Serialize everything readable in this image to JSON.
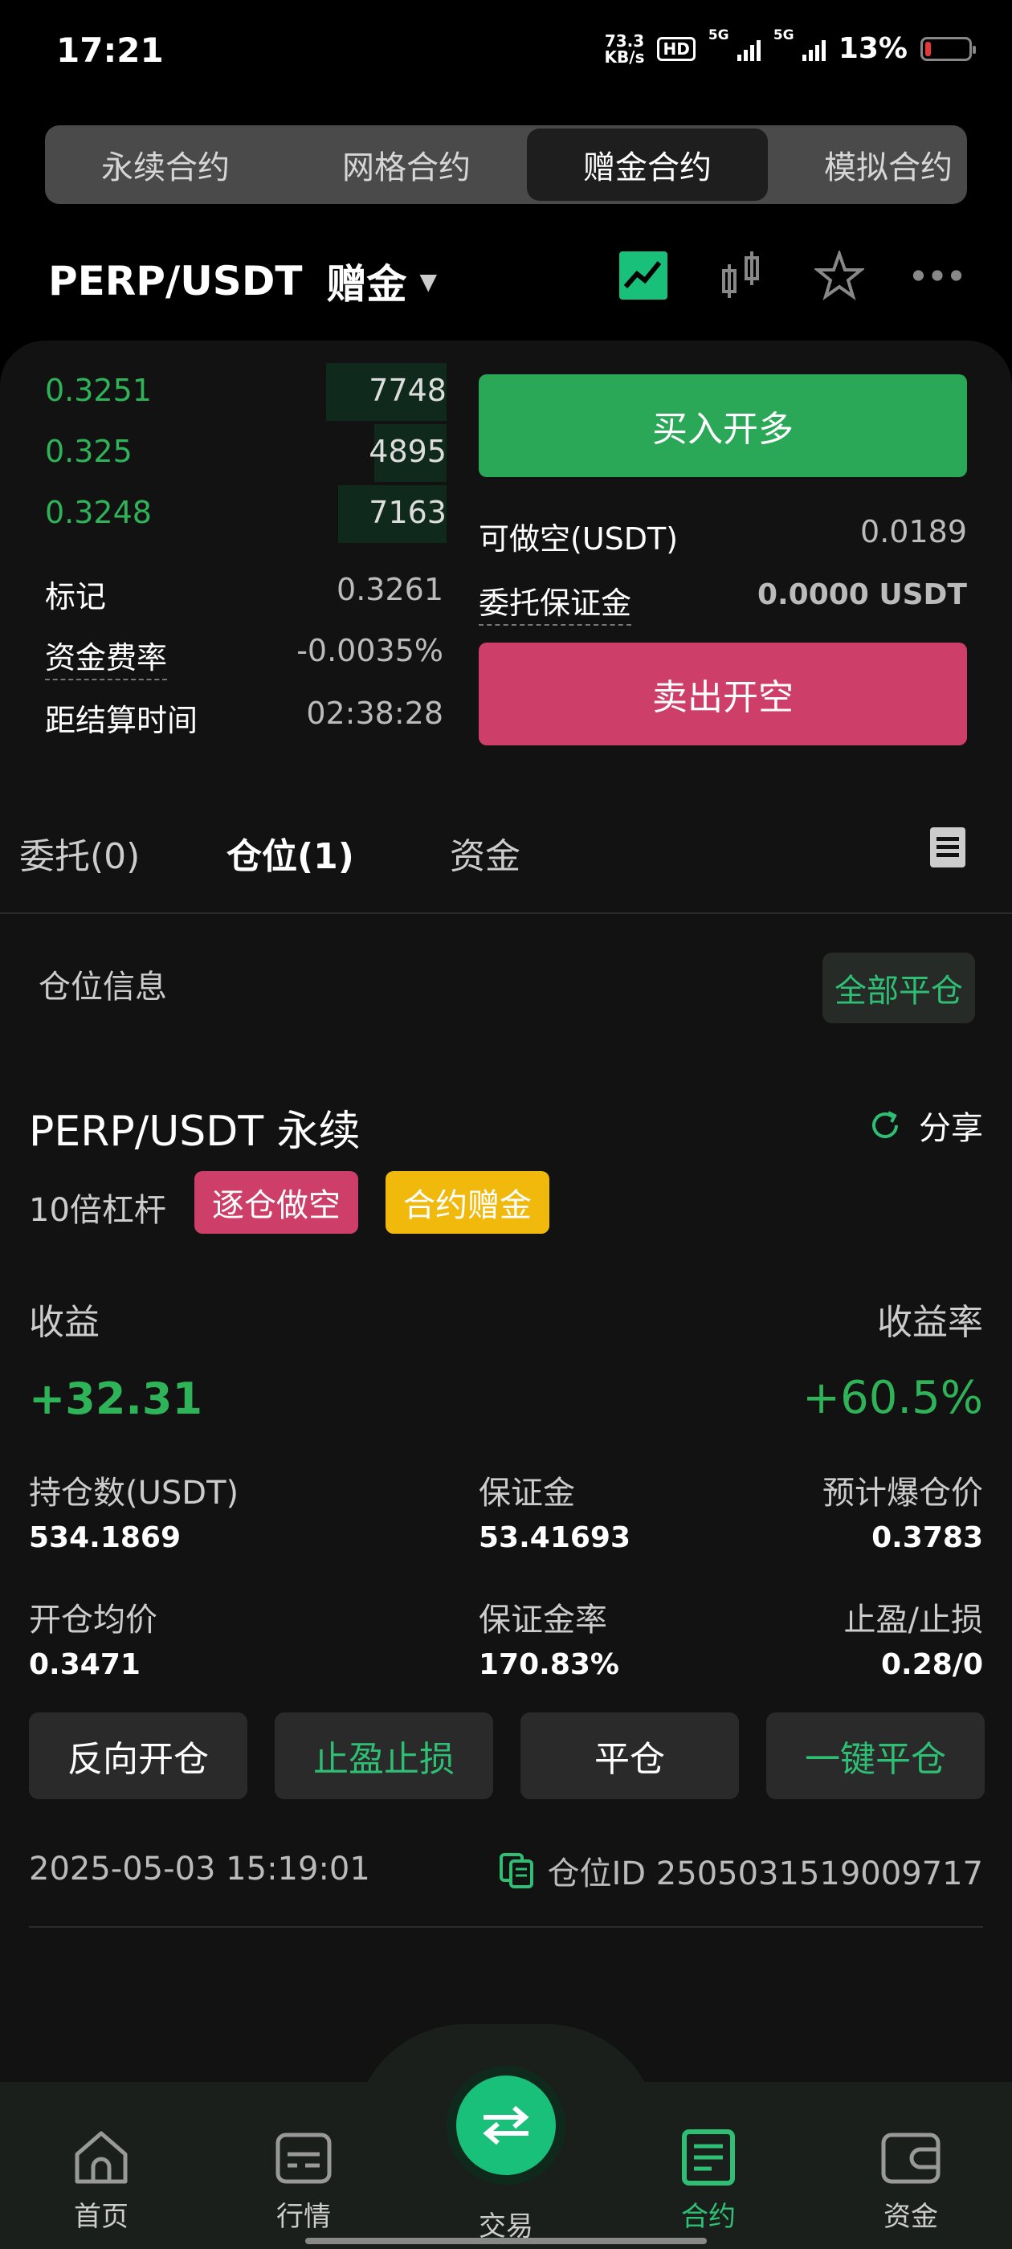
{
  "status": {
    "time": "17:21",
    "net_speed_value": "73.3",
    "net_speed_unit": "KB/s",
    "hd_label": "HD",
    "sim1": "5G",
    "sim2": "5G",
    "battery": "13%",
    "battery_level": 0.13,
    "battery_color": "#e53935"
  },
  "tabs": [
    {
      "label": "永续合约",
      "active": false
    },
    {
      "label": "网格合约",
      "active": false
    },
    {
      "label": "赠金合约",
      "active": true
    },
    {
      "label": "模拟合约",
      "active": false
    }
  ],
  "header": {
    "pair": "PERP/USDT",
    "badge": "赠金",
    "icons": [
      "trend-chart-icon",
      "candlestick-icon",
      "star-icon",
      "more-icon"
    ]
  },
  "orderbook": [
    {
      "price": "0.3251",
      "qty": "7748",
      "depth": 0.5
    },
    {
      "price": "0.325",
      "qty": "4895",
      "depth": 0.3
    },
    {
      "price": "0.3248",
      "qty": "7163",
      "depth": 0.45
    }
  ],
  "market": {
    "mark_label": "标记",
    "mark_value": "0.3261",
    "funding_label": "资金费率",
    "funding_value": "-0.0035%",
    "settle_label": "距结算时间",
    "settle_value": "02:38:28"
  },
  "trade": {
    "long_btn": "买入开多",
    "short_avail_label": "可做空(USDT)",
    "short_avail_value": "0.0189",
    "margin_label": "委托保证金",
    "margin_value": "0.0000 USDT",
    "short_btn": "卖出开空"
  },
  "section_tabs": {
    "orders": "委托(0)",
    "positions": "仓位(1)",
    "assets": "资金"
  },
  "position": {
    "section_title": "仓位信息",
    "close_all": "全部平仓",
    "title": "PERP/USDT 永续",
    "share": "分享",
    "leverage": "10倍杠杆",
    "tag_mode": "逐仓做空",
    "tag_bonus": "合约赠金",
    "pnl_label": "收益",
    "pnl_rate_label": "收益率",
    "pnl": "+32.31",
    "pnl_rate": "+60.5%",
    "size_label": "持仓数(USDT)",
    "size": "534.1869",
    "margin_label": "保证金",
    "margin": "53.41693",
    "liq_label": "预计爆仓价",
    "liq": "0.3783",
    "entry_label": "开仓均价",
    "entry": "0.3471",
    "margin_ratio_label": "保证金率",
    "margin_ratio": "170.83%",
    "tpsl_label": "止盈/止损",
    "tpsl": "0.28/0",
    "actions": [
      "反向开仓",
      "止盈止损",
      "平仓",
      "一键平仓"
    ],
    "timestamp": "2025-05-03 15:19:01",
    "position_id": "仓位ID 2505031519009717"
  },
  "nav": [
    {
      "label": "首页",
      "icon": "home-icon",
      "active": false
    },
    {
      "label": "行情",
      "icon": "market-icon",
      "active": false
    },
    {
      "label": "交易",
      "icon": "swap-icon",
      "active": false
    },
    {
      "label": "合约",
      "icon": "contract-icon",
      "active": true
    },
    {
      "label": "资金",
      "icon": "wallet-icon",
      "active": false
    }
  ],
  "colors": {
    "green": "#2fb358",
    "accent": "#2fbf74",
    "red": "#cd3f68",
    "yellow": "#f0b90b"
  }
}
